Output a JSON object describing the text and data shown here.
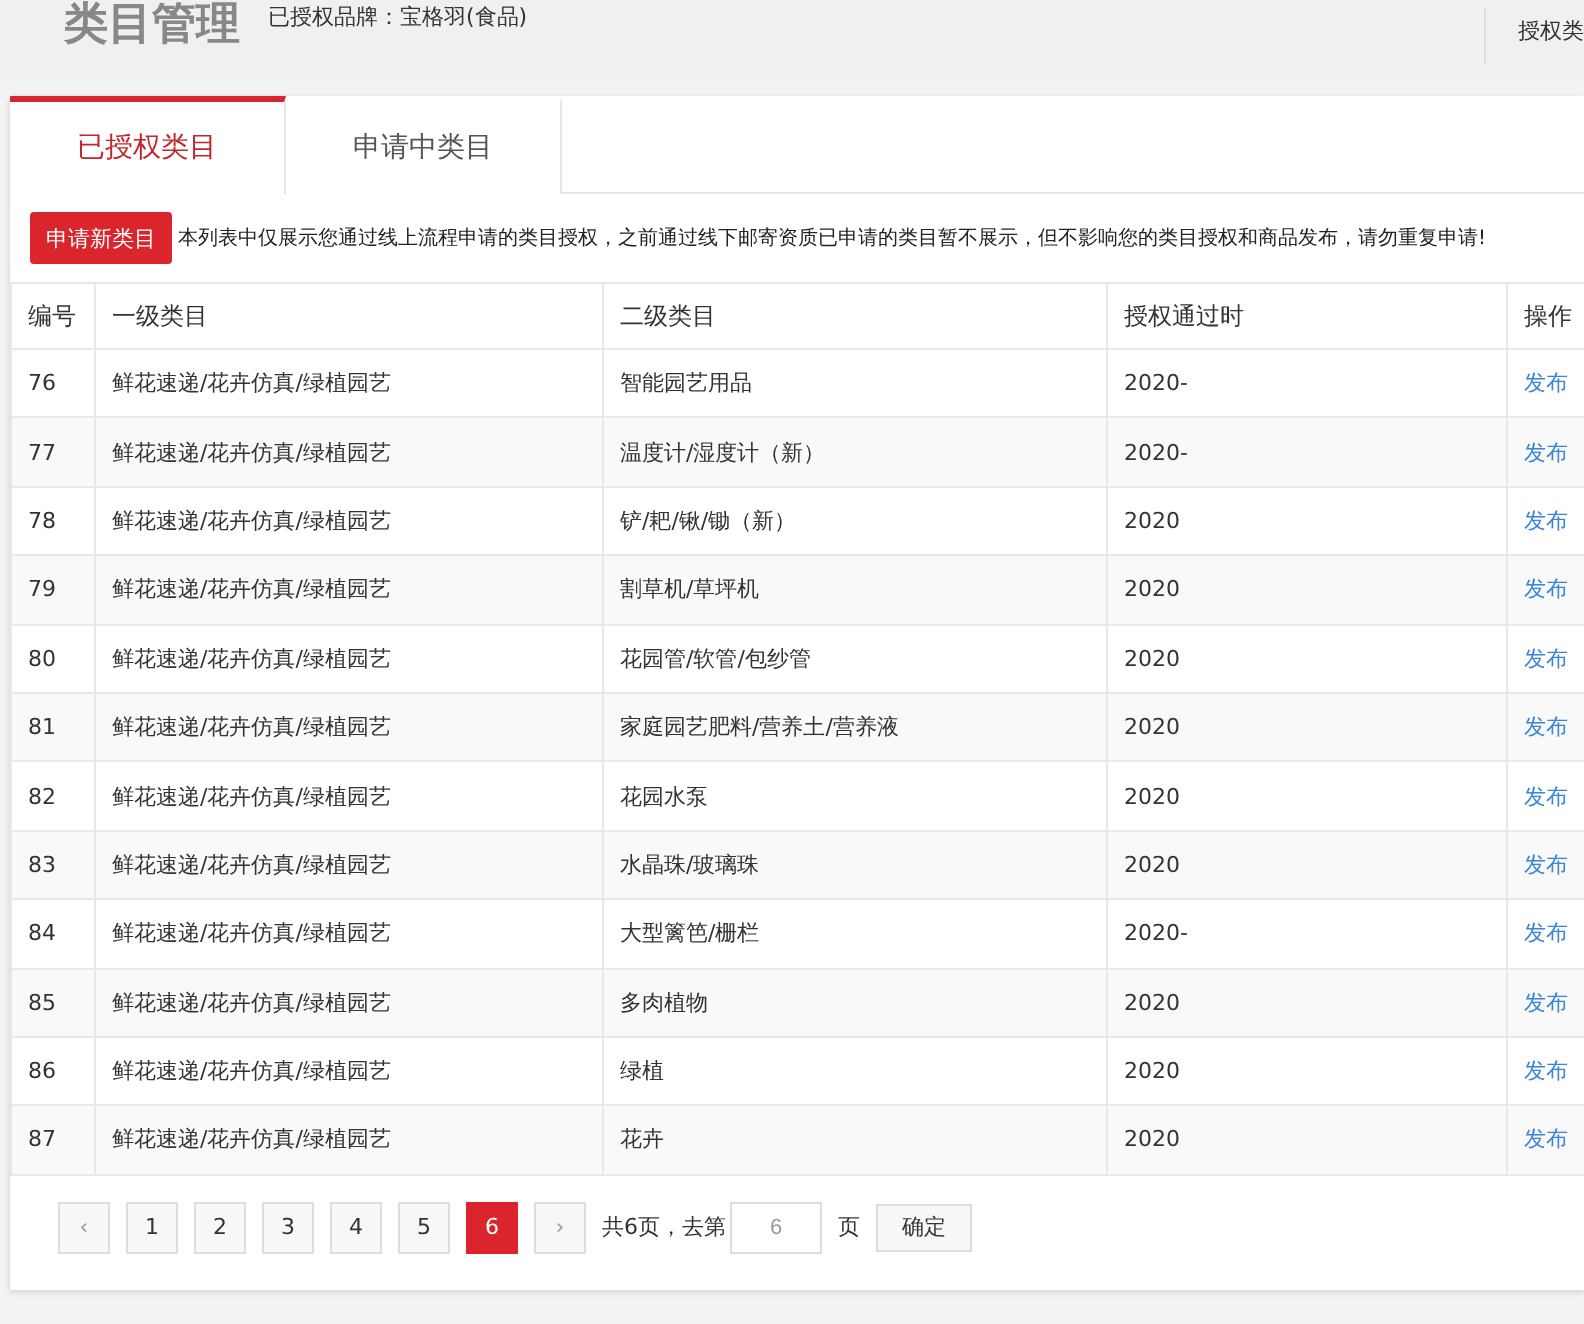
{
  "header": {
    "title": "类目管理",
    "brand": "已授权品牌：宝格羽(食品)",
    "right_link": "授权类"
  },
  "tabs": [
    {
      "label": "已授权类目",
      "selected": true
    },
    {
      "label": "申请中类目",
      "selected": false
    }
  ],
  "notice": {
    "button": "申请新类目",
    "text": "本列表中仅展示您通过线上流程申请的类目授权，之前通过线下邮寄资质已申请的类目暂不展示，但不影响您的类目授权和商品发布，请勿重复申请!"
  },
  "table": {
    "columns": [
      "编号",
      "一级类目",
      "二级类目",
      "授权通过时",
      "操作"
    ],
    "rows": [
      {
        "id": "76",
        "level1": "鲜花速递/花卉仿真/绿植园艺",
        "level2": "智能园艺用品",
        "date": "2020-",
        "action": "发布"
      },
      {
        "id": "77",
        "level1": "鲜花速递/花卉仿真/绿植园艺",
        "level2": "温度计/湿度计（新）",
        "date": "2020-",
        "action": "发布"
      },
      {
        "id": "78",
        "level1": "鲜花速递/花卉仿真/绿植园艺",
        "level2": "铲/耙/锹/锄（新）",
        "date": "2020",
        "action": "发布"
      },
      {
        "id": "79",
        "level1": "鲜花速递/花卉仿真/绿植园艺",
        "level2": "割草机/草坪机",
        "date": "2020",
        "action": "发布"
      },
      {
        "id": "80",
        "level1": "鲜花速递/花卉仿真/绿植园艺",
        "level2": "花园管/软管/包纱管",
        "date": "2020",
        "action": "发布"
      },
      {
        "id": "81",
        "level1": "鲜花速递/花卉仿真/绿植园艺",
        "level2": "家庭园艺肥料/营养土/营养液",
        "date": "2020",
        "action": "发布"
      },
      {
        "id": "82",
        "level1": "鲜花速递/花卉仿真/绿植园艺",
        "level2": "花园水泵",
        "date": "2020",
        "action": "发布"
      },
      {
        "id": "83",
        "level1": "鲜花速递/花卉仿真/绿植园艺",
        "level2": "水晶珠/玻璃珠",
        "date": "2020",
        "action": "发布"
      },
      {
        "id": "84",
        "level1": "鲜花速递/花卉仿真/绿植园艺",
        "level2": "大型篱笆/栅栏",
        "date": "2020-",
        "action": "发布"
      },
      {
        "id": "85",
        "level1": "鲜花速递/花卉仿真/绿植园艺",
        "level2": "多肉植物",
        "date": "2020",
        "action": "发布"
      },
      {
        "id": "86",
        "level1": "鲜花速递/花卉仿真/绿植园艺",
        "level2": "绿植",
        "date": "2020",
        "action": "发布"
      },
      {
        "id": "87",
        "level1": "鲜花速递/花卉仿真/绿植园艺",
        "level2": "花卉",
        "date": "2020",
        "action": "发布"
      }
    ]
  },
  "pagination": {
    "prev": "‹",
    "next": "›",
    "pages": [
      {
        "label": "1",
        "selected": false
      },
      {
        "label": "2",
        "selected": false
      },
      {
        "label": "3",
        "selected": false
      },
      {
        "label": "4",
        "selected": false
      },
      {
        "label": "5",
        "selected": false
      },
      {
        "label": "6",
        "selected": true
      }
    ],
    "summary": "共6页，去第",
    "page_input": "6",
    "unit": "页",
    "confirm": "确定"
  }
}
